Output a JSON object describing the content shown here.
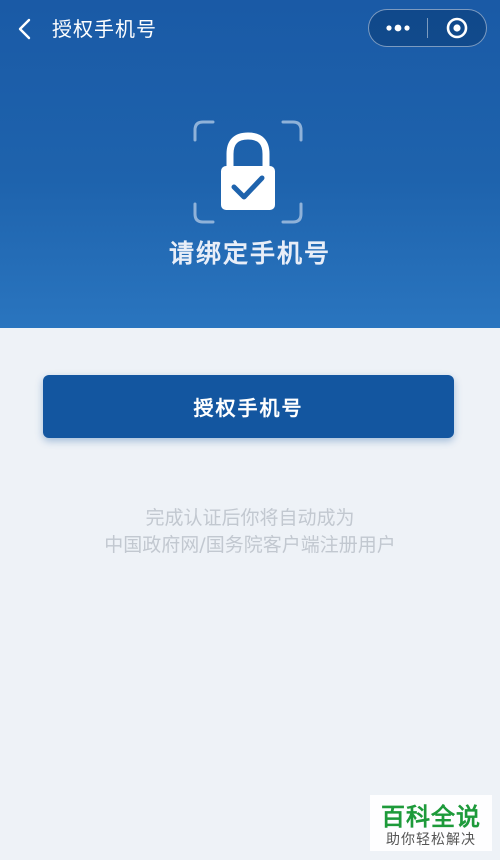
{
  "nav": {
    "title": "授权手机号",
    "back_icon": "chevron-left-icon",
    "menu_icon": "more-dots-icon",
    "close_icon": "target-close-icon"
  },
  "hero": {
    "icon": "lock-check-icon",
    "title": "请绑定手机号"
  },
  "main": {
    "auth_button_label": "授权手机号",
    "note_line1": "完成认证后你将自动成为",
    "note_line2": "中国政府网/国务院客户端注册用户"
  },
  "watermark": {
    "title": "百科全说",
    "subtitle": "助你轻松解决"
  },
  "colors": {
    "hero_background": "#1e63ad",
    "button_background": "#1356a0",
    "page_background": "#eef2f7",
    "note_text": "#c2c8d0",
    "watermark_green": "#1d9a3a"
  }
}
